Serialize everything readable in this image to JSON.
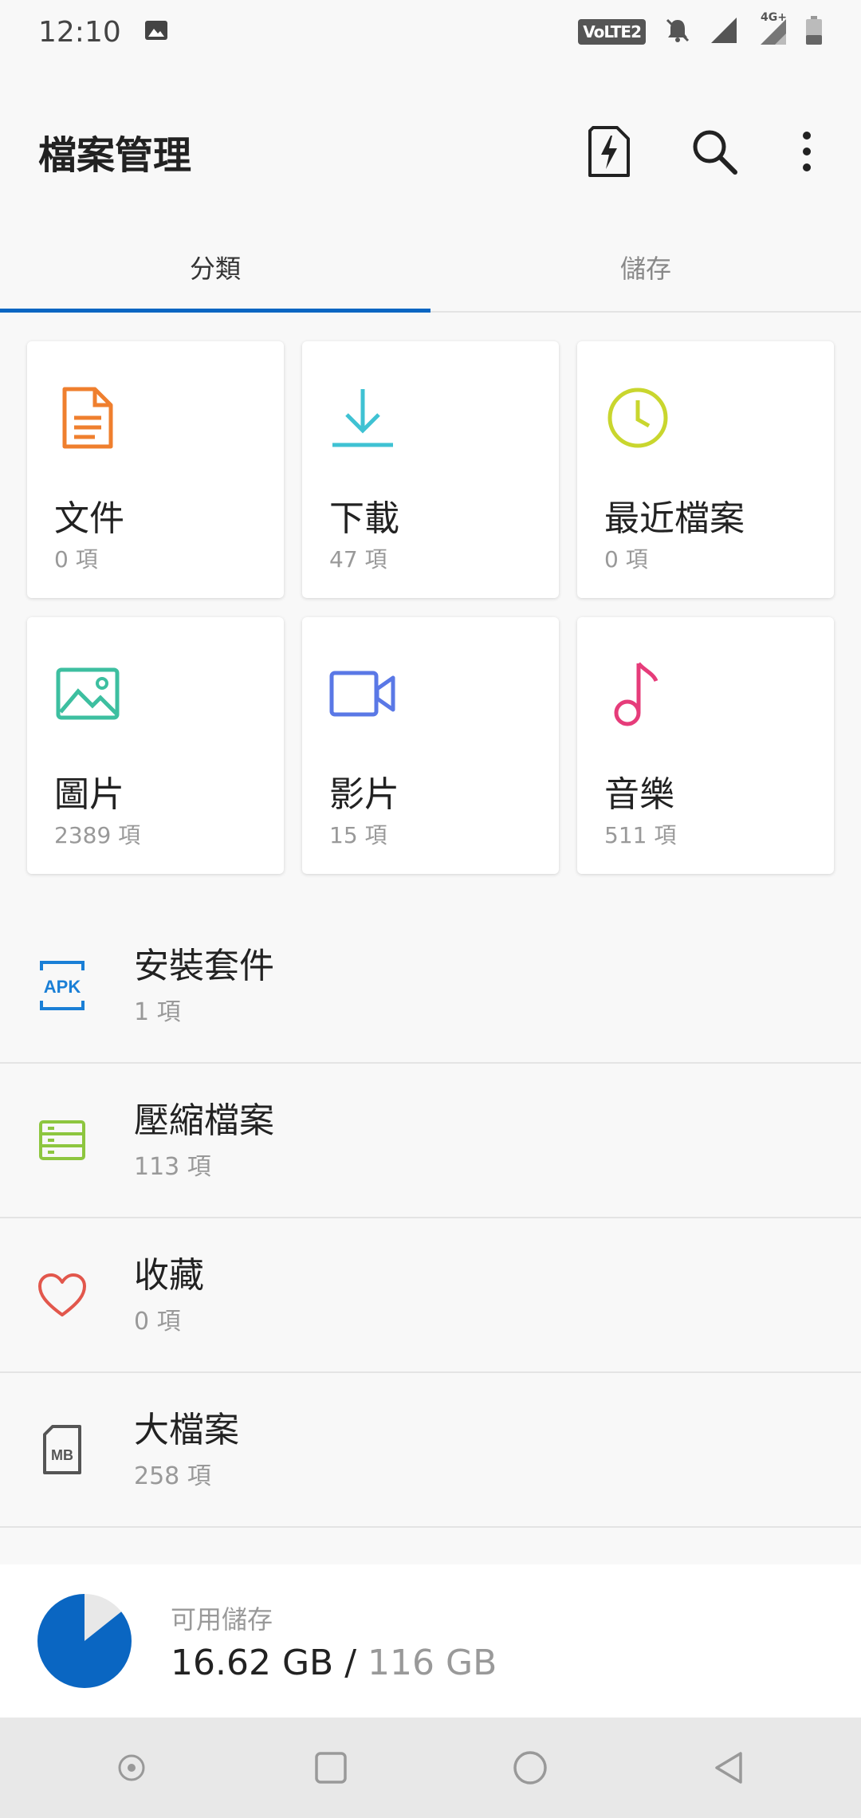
{
  "status_bar": {
    "time": "12:10",
    "volte": "VoLTE2",
    "network": "4G+",
    "icons": [
      "image-icon",
      "mute-icon",
      "signal-icon",
      "signal-4g-icon",
      "battery-icon"
    ]
  },
  "app_bar": {
    "title": "檔案管理",
    "actions": [
      "quick-file-icon",
      "search-icon",
      "more-vert-icon"
    ]
  },
  "tabs": [
    {
      "label": "分類",
      "active": true
    },
    {
      "label": "儲存",
      "active": false
    }
  ],
  "categories": [
    {
      "title": "文件",
      "count": "0 項",
      "icon": "document-icon",
      "color": "#ef7f2e"
    },
    {
      "title": "下載",
      "count": "47 項",
      "icon": "download-icon",
      "color": "#3fc2d3"
    },
    {
      "title": "最近檔案",
      "count": "0 項",
      "icon": "clock-icon",
      "color": "#c9d62e"
    },
    {
      "title": "圖片",
      "count": "2389 項",
      "icon": "image-icon",
      "color": "#3dbfa0"
    },
    {
      "title": "影片",
      "count": "15 項",
      "icon": "video-icon",
      "color": "#5a78e6"
    },
    {
      "title": "音樂",
      "count": "511 項",
      "icon": "music-icon",
      "color": "#e63c7a"
    }
  ],
  "list": [
    {
      "title": "安裝套件",
      "count": "1 項",
      "icon": "apk-icon",
      "icon_text": "APK",
      "color": "#1a7fd6"
    },
    {
      "title": "壓縮檔案",
      "count": "113 項",
      "icon": "archive-icon",
      "color": "#8dc63f"
    },
    {
      "title": "收藏",
      "count": "0 項",
      "icon": "heart-icon",
      "color": "#e2574c"
    },
    {
      "title": "大檔案",
      "count": "258 項",
      "icon": "large-file-icon",
      "icon_text": "MB",
      "color": "#555555"
    }
  ],
  "storage": {
    "label": "可用儲存",
    "free": "16.62 GB",
    "separator": " / ",
    "total": "116 GB",
    "used_fraction": 0.857,
    "used_color": "#0a66c2",
    "free_color": "#e8e8e8"
  },
  "navbar": [
    "assistant-icon",
    "recents-icon",
    "home-icon",
    "back-icon"
  ]
}
